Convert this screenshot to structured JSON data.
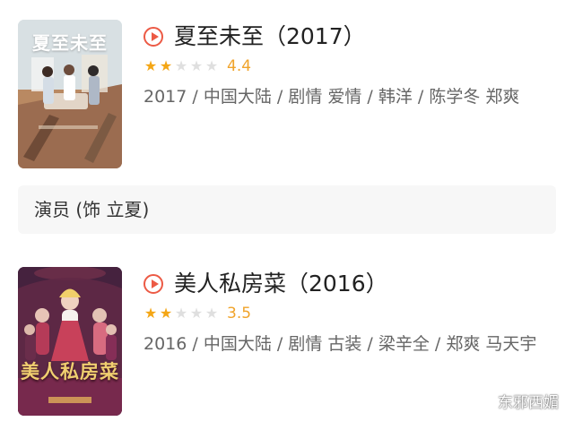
{
  "movies": [
    {
      "title": "夏至未至（2017）",
      "rating": {
        "score": "4.4",
        "stars_filled": 2,
        "stars_total": 5
      },
      "meta": "2017 / 中国大陆 / 剧情 爱情 / 韩洋 / 陈学冬 郑爽",
      "poster_text": "夏至未至"
    },
    {
      "title": "美人私房菜（2016）",
      "rating": {
        "score": "3.5",
        "stars_filled": 2,
        "stars_total": 5
      },
      "meta": "2016 / 中国大陆 / 剧情 古装 / 梁辛全 / 郑爽 马天宇",
      "poster_text": "美人私房菜"
    }
  ],
  "cast_note": "演员 (饰 立夏)",
  "watermark": "东邪西媚",
  "icons": {
    "play": "play-circle-icon",
    "star": "star-icon",
    "wechat": "wechat-icon"
  },
  "colors": {
    "accent": "#ec5a45",
    "star": "#f4a615",
    "score": "#f0a32a"
  }
}
